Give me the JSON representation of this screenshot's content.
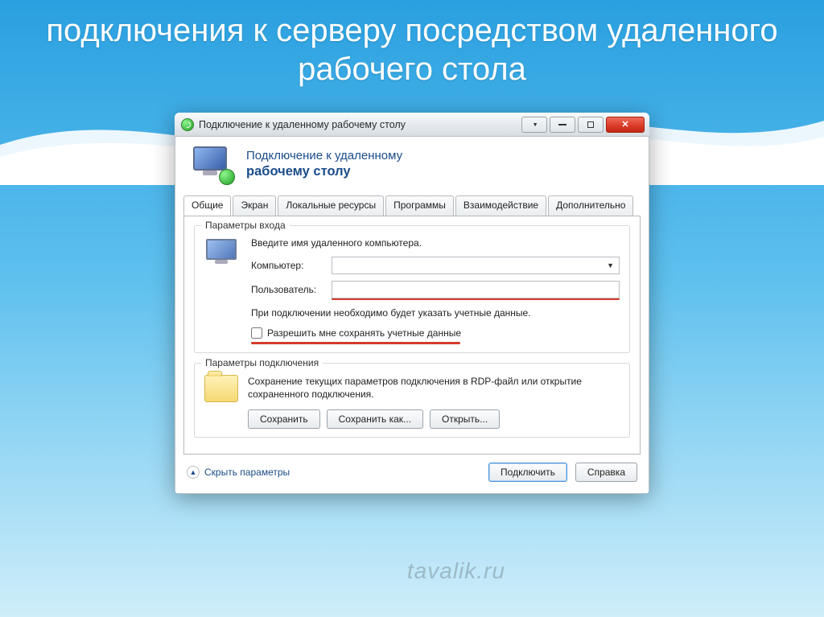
{
  "slide_title": "подключения к серверу посредством удаленного рабочего стола",
  "window": {
    "title": "Подключение к удаленному рабочему столу"
  },
  "banner": {
    "line1": "Подключение к удаленному",
    "line2": "рабочему столу"
  },
  "tabs": [
    {
      "label": "Общие",
      "active": true
    },
    {
      "label": "Экран",
      "active": false
    },
    {
      "label": "Локальные ресурсы",
      "active": false
    },
    {
      "label": "Программы",
      "active": false
    },
    {
      "label": "Взаимодействие",
      "active": false
    },
    {
      "label": "Дополнительно",
      "active": false
    }
  ],
  "login": {
    "group_title": "Параметры входа",
    "hint": "Введите имя удаленного компьютера.",
    "computer_label": "Компьютер:",
    "computer_value": "",
    "user_label": "Пользователь:",
    "user_value": "",
    "note": "При подключении необходимо будет указать учетные данные.",
    "allow_save": "Разрешить мне сохранять учетные данные",
    "allow_save_checked": false
  },
  "connection": {
    "group_title": "Параметры подключения",
    "description": "Сохранение текущих параметров подключения в RDP-файл или открытие сохраненного подключения.",
    "save": "Сохранить",
    "save_as": "Сохранить как...",
    "open": "Открыть..."
  },
  "footer": {
    "hide_params": "Скрыть параметры",
    "connect": "Подключить",
    "help": "Справка"
  },
  "watermark": "tavalik.ru"
}
